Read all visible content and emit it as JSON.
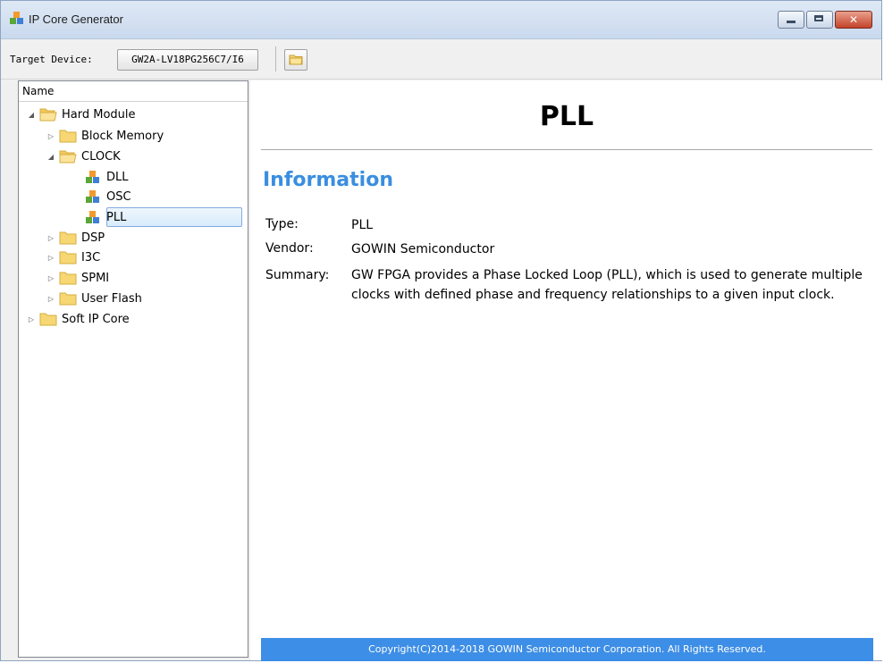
{
  "window": {
    "title": "IP Core Generator",
    "icon": "ip-cubes-icon"
  },
  "toolbar": {
    "target_device_label": "Target Device:",
    "target_device_value": "GW2A-LV18PG256C7/I6",
    "open_icon": "folder-icon"
  },
  "tree": {
    "header": "Name",
    "items": [
      {
        "label": "Hard Module",
        "level": 0,
        "expanded": true,
        "icon": "folder-open-icon"
      },
      {
        "label": "Block Memory",
        "level": 1,
        "expanded": false,
        "icon": "folder-icon"
      },
      {
        "label": "CLOCK",
        "level": 1,
        "expanded": true,
        "icon": "folder-open-icon"
      },
      {
        "label": "DLL",
        "level": 2,
        "icon": "ip-cubes-icon"
      },
      {
        "label": "OSC",
        "level": 2,
        "icon": "ip-cubes-icon"
      },
      {
        "label": "PLL",
        "level": 2,
        "icon": "ip-cubes-icon",
        "selected": true
      },
      {
        "label": "DSP",
        "level": 1,
        "expanded": false,
        "icon": "folder-icon"
      },
      {
        "label": "I3C",
        "level": 1,
        "expanded": false,
        "icon": "folder-icon"
      },
      {
        "label": "SPMI",
        "level": 1,
        "expanded": false,
        "icon": "folder-icon"
      },
      {
        "label": "User Flash",
        "level": 1,
        "expanded": false,
        "icon": "folder-icon"
      },
      {
        "label": "Soft IP Core",
        "level": 0,
        "expanded": false,
        "icon": "folder-icon"
      }
    ]
  },
  "content": {
    "title": "PLL",
    "section_heading": "Information",
    "info": {
      "type_label": "Type:",
      "type_value": "PLL",
      "vendor_label": "Vendor:",
      "vendor_value": "GOWIN Semiconductor",
      "summary_label": "Summary:",
      "summary_value": "GW FPGA provides a Phase Locked Loop (PLL), which is used to generate multiple clocks with defined phase and frequency relationships to a given input clock."
    },
    "footer": "Copyright(C)2014-2018 GOWIN Semiconductor Corporation. All Rights Reserved."
  },
  "colors": {
    "accent": "#3a8ee0",
    "footer_bg": "#3d8ee6",
    "selection_border": "#84acdd",
    "folder": "#f7d774"
  }
}
